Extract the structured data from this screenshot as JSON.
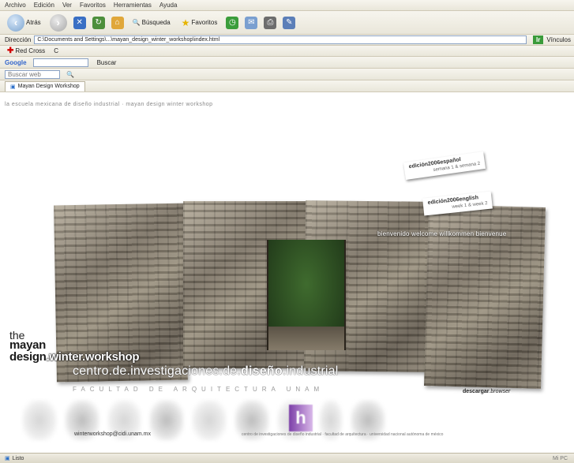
{
  "menu": [
    "Archivo",
    "Edición",
    "Ver",
    "Favoritos",
    "Herramientas",
    "Ayuda"
  ],
  "nav": {
    "back": "Atrás",
    "search": "Búsqueda",
    "favorites": "Favoritos"
  },
  "address": {
    "label": "Dirección",
    "url": "C:\\Documents and Settings\\...\\mayan_design_winter_workshop\\index.html",
    "go": "Ir",
    "links": "Vínculos"
  },
  "links_bar": [
    "Red Cross",
    "C"
  ],
  "google": {
    "label": "Google",
    "button": "Buscar"
  },
  "yahoo": {
    "placeholder": "Buscar web"
  },
  "tab": {
    "label": "Mayan Design Workshop"
  },
  "site": {
    "tagline": "la escuela mexicana de diseño industrial  ·  mayan design winter workshop",
    "welcome": "bienvenido welcome willkommen bienvenue",
    "tag1_main": "edición2006español",
    "tag1_sub": "semana 1 & semana 2",
    "tag2_main": "edición2006english",
    "tag2_sub": "week 1 & week 2",
    "the": "the",
    "mayan": "mayan",
    "design": "design",
    "winter_workshop": ".winter.workshop",
    "centro_a": "centro.de.investigaciones.de.",
    "centro_b": "diseño",
    "centro_c": ".industrial",
    "facultad": "FACULTAD DE ARQUITECTURA   UNAM",
    "descargar_bold": "descargar",
    "descargar_rest": ".browser",
    "email": "winterworkshop@cidi.unam.mx",
    "footnote": "centro de investigaciones de diseño industrial · facultad de arquitectura · universidad nacional autónoma de méxico"
  },
  "status": {
    "left": "Listo",
    "right": "Mi PC"
  }
}
